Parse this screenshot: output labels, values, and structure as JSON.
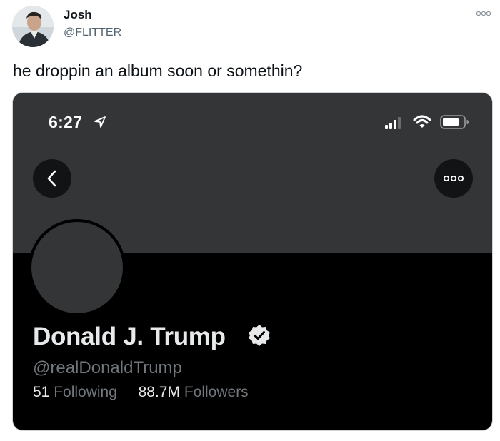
{
  "tweet": {
    "author_name": "Josh",
    "author_handle": "@FLITTER",
    "text": "he droppin an album soon or somethin?",
    "more_icon": "more-dots-icon"
  },
  "embedded_screenshot": {
    "status_bar": {
      "time": "6:27",
      "icons": [
        "location-arrow-icon",
        "cellular-signal-icon",
        "wifi-icon",
        "battery-icon"
      ]
    },
    "nav": {
      "back_icon": "chevron-left-icon",
      "more_icon": "more-dots-icon"
    },
    "profile": {
      "display_name": "Donald J. Trump",
      "verified": true,
      "handle": "@realDonaldTrump",
      "following_count": "51",
      "following_label": "Following",
      "followers_count": "88.7M",
      "followers_label": "Followers"
    },
    "colors": {
      "banner": "#343536",
      "background": "#000000",
      "primary_text": "#e7e9ea",
      "secondary_text": "#71767b",
      "button_bg": "#121314"
    }
  }
}
